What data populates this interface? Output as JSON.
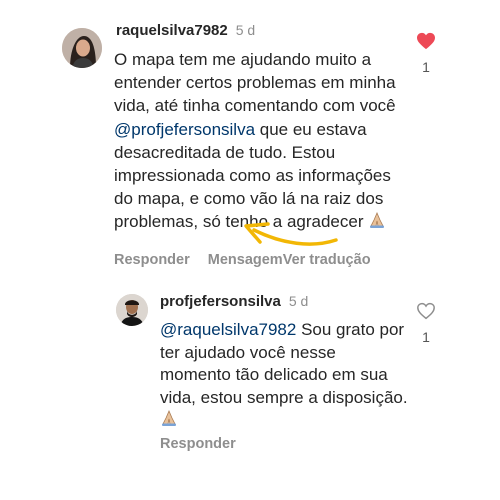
{
  "comments": [
    {
      "username": "raquelsilva7982",
      "time": "5 d",
      "text_part1": "O mapa tem me ajudando muito a entender certos problemas em minha vida, até tinha comentando com você ",
      "mention": "@profjefersonsilva",
      "text_part2": " que eu estava desacreditada de tudo. Estou impressionada como as informações do mapa, e como vão lá na raiz dos problemas, só tenho a agradecer",
      "reply_label": "Responder",
      "action_2_label": "Mensagem",
      "action_3_label": "Ver tradução",
      "like_count": "1",
      "liked": true,
      "emoji": "folded-hands"
    },
    {
      "username": "profjefersonsilva",
      "time": "5 d",
      "mention": "@raquelsilva7982",
      "text": " Sou grato por ter ajudado você nesse momento tão delicado em sua vida, estou sempre a disposição.",
      "reply_label": "Responder",
      "like_count": "1",
      "liked": false,
      "emoji": "folded-hands"
    }
  ],
  "colors": {
    "like_red": "#ed4956",
    "mention_blue": "#00376b",
    "arrow_yellow": "#f2b705",
    "muted_gray": "#8e8e8e"
  },
  "icons": [
    "heart-filled-icon",
    "heart-outline-icon",
    "folded-hands-emoji",
    "annotation-arrow"
  ]
}
